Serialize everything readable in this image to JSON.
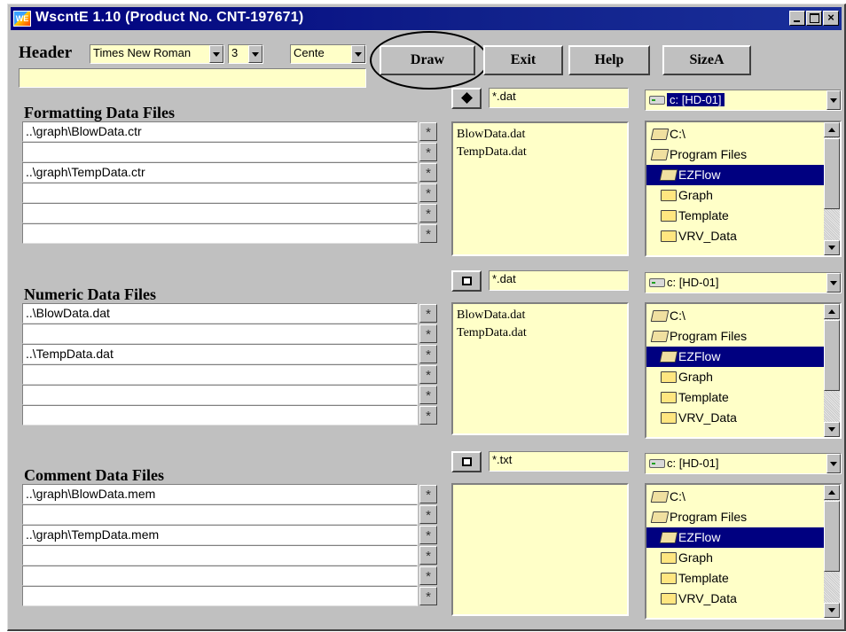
{
  "window": {
    "title": "WscntE 1.10 (Product No. CNT-197671)",
    "icon_label": "WE",
    "close_glyph": "×"
  },
  "header": {
    "label": "Header",
    "font_name": "Times New Roman",
    "font_size": "3",
    "alignment": "Cente",
    "title_value": ""
  },
  "buttons": {
    "draw": "Draw",
    "exit": "Exit",
    "help": "Help",
    "size": "SizeA"
  },
  "star_glyph": "*",
  "sections": [
    {
      "title": "Formatting Data Files",
      "paths": [
        "..\\graph\\BlowData.ctr",
        "",
        "..\\graph\\TempData.ctr",
        "",
        "",
        ""
      ],
      "filter": "*.dat",
      "selector_filled": true,
      "files": [
        "BlowData.dat",
        "TempData.dat"
      ],
      "drive": "c: [HD-01]",
      "drive_selected": true
    },
    {
      "title": "Numeric Data Files",
      "paths": [
        "..\\BlowData.dat",
        "",
        "..\\TempData.dat",
        "",
        "",
        ""
      ],
      "filter": "*.dat",
      "selector_filled": false,
      "files": [
        "BlowData.dat",
        "TempData.dat"
      ],
      "drive": "c: [HD-01]",
      "drive_selected": false
    },
    {
      "title": "Comment Data Files",
      "paths": [
        "..\\graph\\BlowData.mem",
        "",
        "..\\graph\\TempData.mem",
        "",
        "",
        ""
      ],
      "filter": "*.txt",
      "selector_filled": false,
      "files": [],
      "drive": "c: [HD-01]",
      "drive_selected": false
    }
  ],
  "directories": [
    {
      "name": "C:\\",
      "level": 0,
      "open": true,
      "selected": false
    },
    {
      "name": "Program Files",
      "level": 0,
      "open": true,
      "selected": false
    },
    {
      "name": "EZFlow",
      "level": 1,
      "open": true,
      "selected": true
    },
    {
      "name": "Graph",
      "level": 1,
      "open": false,
      "selected": false
    },
    {
      "name": "Template",
      "level": 1,
      "open": false,
      "selected": false
    },
    {
      "name": "VRV_Data",
      "level": 1,
      "open": false,
      "selected": false
    }
  ]
}
